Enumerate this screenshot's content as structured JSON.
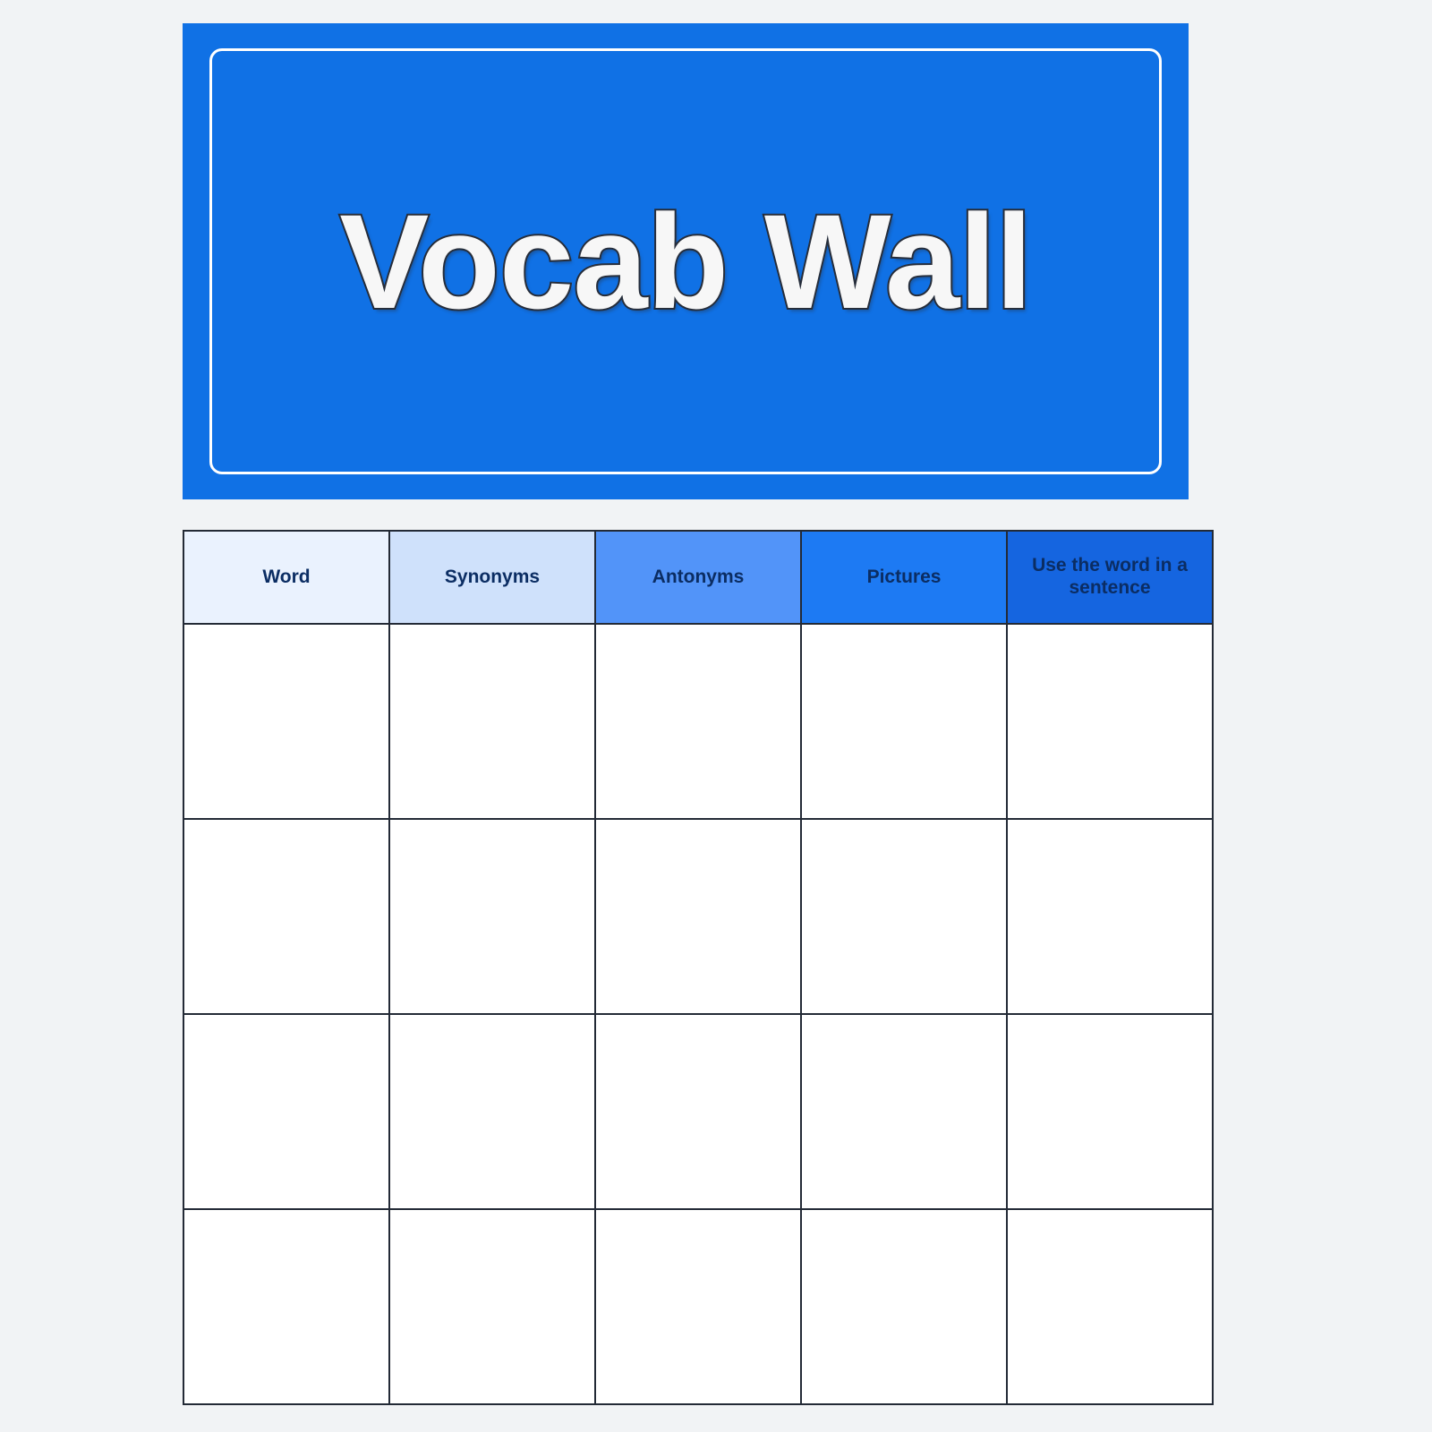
{
  "page": {
    "background_color": "#f1f3f5"
  },
  "banner": {
    "title": "Vocab Wall",
    "background_color": "#1071e5",
    "frame_color": "#ffffff",
    "title_color": "#f7f7f7",
    "title_outline_color": "#262d3a"
  },
  "table": {
    "text_color": "#0b2d63",
    "border_color": "#232a36",
    "cell_background": "#ffffff",
    "columns": [
      {
        "label": "Word",
        "background_color": "#eaf2fe"
      },
      {
        "label": "Synonyms",
        "background_color": "#cfe1fb"
      },
      {
        "label": "Antonyms",
        "background_color": "#5294f9"
      },
      {
        "label": "Pictures",
        "background_color": "#1d7af3"
      },
      {
        "label": "Use the word in a sentence",
        "background_color": "#1565e0"
      }
    ],
    "rows": [
      {
        "cells": [
          "",
          "",
          "",
          "",
          ""
        ]
      },
      {
        "cells": [
          "",
          "",
          "",
          "",
          ""
        ]
      },
      {
        "cells": [
          "",
          "",
          "",
          "",
          ""
        ]
      },
      {
        "cells": [
          "",
          "",
          "",
          "",
          ""
        ]
      }
    ]
  }
}
